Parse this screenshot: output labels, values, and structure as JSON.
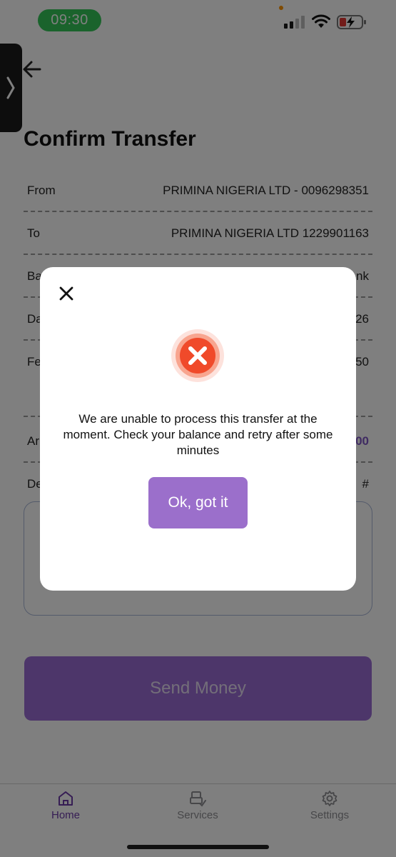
{
  "status_bar": {
    "time": "09:30"
  },
  "header": {
    "title": "Confirm Transfer"
  },
  "details": {
    "from": {
      "label": "From",
      "value": "PRIMINA NIGERIA LTD - 0096298351"
    },
    "to": {
      "label": "To",
      "value": "PRIMINA NIGERIA LTD 1229901163"
    },
    "bank": {
      "label": "Ba",
      "value": "nk"
    },
    "date": {
      "label": "Da",
      "value": "26"
    },
    "fee": {
      "label": "Fe",
      "value": "50"
    },
    "amount": {
      "label": "Ar",
      "value": "00"
    }
  },
  "description": {
    "label": "De",
    "hash": "#"
  },
  "send_button": {
    "label": "Send Money"
  },
  "dialog": {
    "message": "We are unable to process this transfer at the moment. Check your balance and retry after some minutes",
    "ok_label": "Ok, got it",
    "icon": "error-x-icon"
  },
  "bottom_nav": {
    "items": [
      {
        "label": "Home",
        "icon": "home-icon",
        "active": true
      },
      {
        "label": "Services",
        "icon": "services-icon",
        "active": false
      },
      {
        "label": "Settings",
        "icon": "settings-icon",
        "active": false
      }
    ]
  },
  "colors": {
    "accent": "#7f56c4",
    "error": "#f04a2a",
    "status_green": "#34c759"
  }
}
